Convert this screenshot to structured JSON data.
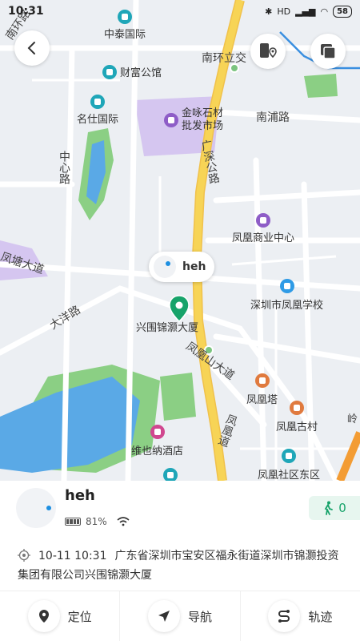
{
  "status": {
    "time": "10:31",
    "battery": "58",
    "network": "HD"
  },
  "map": {
    "device_bubble_name": "heh",
    "pin_label": "兴围锦灏大厦",
    "pois": [
      {
        "key": "zhongtai",
        "label": "中泰国际",
        "icon": "building-icon",
        "color": "#1fa6b8"
      },
      {
        "key": "caifu",
        "label": "财富公馆",
        "icon": "building-icon",
        "color": "#1fa6b8"
      },
      {
        "key": "mingshi",
        "label": "名仕国际",
        "icon": "building-icon",
        "color": "#1fa6b8"
      },
      {
        "key": "jinyong",
        "label": "金咏石材\n批发市场",
        "icon": "shopping-icon",
        "color": "#8e5dc7"
      },
      {
        "key": "fenghuang_shangye",
        "label": "凤凰商业中心",
        "icon": "shopping-icon",
        "color": "#8e5dc7"
      },
      {
        "key": "xuexiao",
        "label": "深圳市凤凰学校",
        "icon": "school-icon",
        "color": "#2f9be6"
      },
      {
        "key": "fenghuang_ta",
        "label": "凤凰塔",
        "icon": "temple-icon",
        "color": "#e07a3e"
      },
      {
        "key": "fenghuang_gucun",
        "label": "凤凰古村",
        "icon": "temple-icon",
        "color": "#e07a3e"
      },
      {
        "key": "weiyena",
        "label": "维也纳酒店",
        "icon": "hotel-icon",
        "color": "#d0478f"
      },
      {
        "key": "dongqu",
        "label": "凤凰社区东区",
        "icon": "building-icon",
        "color": "#1fa6b8"
      }
    ],
    "roads": {
      "nanhuan_lu": "南环路",
      "nanhuan_lijiao": "南环立交",
      "nanpu_lu": "南浦路",
      "guangshen_gonglu": "广深公路",
      "zhongxin_lu": "中心路",
      "fengtang_dadao": "凤塘大道",
      "dayang_lu": "大洋路",
      "fenghuangshan_dadao": "凤凰山大道",
      "fenghuang_dao": "凤凰道",
      "ling": "岭"
    }
  },
  "device": {
    "name": "heh",
    "battery": "81%",
    "steps": "0"
  },
  "location": {
    "time": "10-11 10:31",
    "address": "广东省深圳市宝安区福永街道深圳市锦灏投资集团有限公司兴围锦灏大厦"
  },
  "actions": [
    {
      "label": "定位",
      "icon": "locate-icon"
    },
    {
      "label": "导航",
      "icon": "navigation-icon"
    },
    {
      "label": "轨迹",
      "icon": "track-icon"
    }
  ],
  "colors": {
    "accent_green": "#17a36a",
    "road_yellow": "#f7d456",
    "water": "#5aa9e6",
    "park": "#8bcf84",
    "commercial": "#d5c6f0"
  }
}
